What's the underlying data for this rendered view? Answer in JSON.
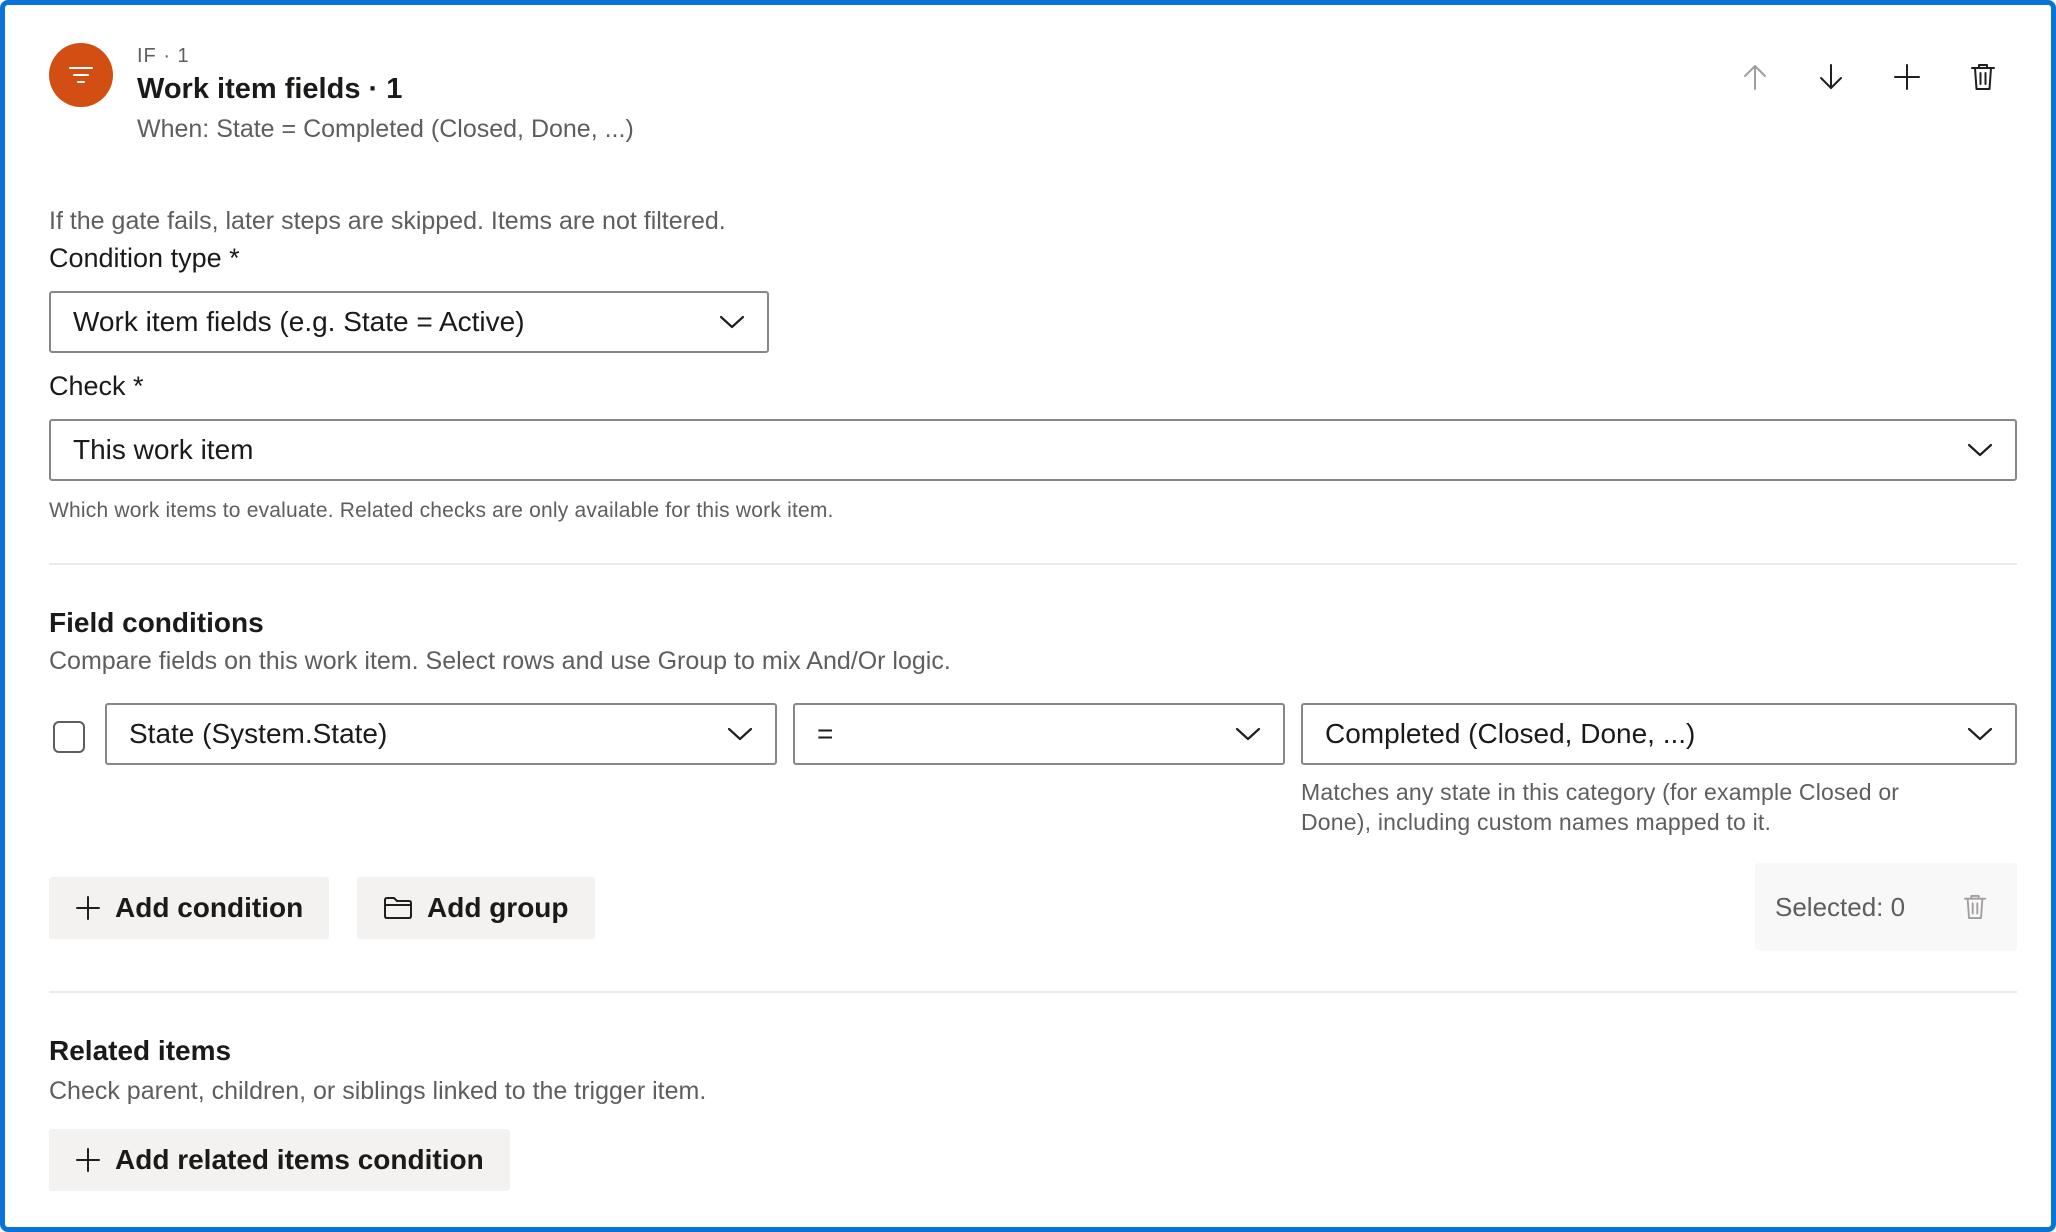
{
  "header": {
    "eyebrow": "IF · 1",
    "title": "Work item fields · 1",
    "subtitle": "When: State = Completed (Closed, Done, ...)",
    "icon": "filter-icon",
    "accent_color": "#d24e12"
  },
  "toolbar": {
    "move_up": "arrow-up-icon",
    "move_down": "arrow-down-icon",
    "add": "plus-icon",
    "delete": "trash-icon"
  },
  "gate_note": "If the gate fails, later steps are skipped. Items are not filtered.",
  "condition_type": {
    "label": "Condition type *",
    "value": "Work item fields (e.g. State = Active)"
  },
  "check": {
    "label": "Check *",
    "value": "This work item",
    "help": "Which work items to evaluate. Related checks are only available for this work item."
  },
  "field_conditions": {
    "title": "Field conditions",
    "description": "Compare fields on this work item. Select rows and use Group to mix And/Or logic.",
    "rows": [
      {
        "field": "State (System.State)",
        "operator": "=",
        "value": "Completed (Closed, Done, ...)",
        "help_line1": "Matches any state in this category (for example Closed or",
        "help_line2": "Done), including custom names mapped to it."
      }
    ],
    "add_condition_label": "Add condition",
    "add_group_label": "Add group",
    "selected_label": "Selected: 0"
  },
  "related_items": {
    "title": "Related items",
    "description": "Check parent, children, or siblings linked to the trigger item.",
    "add_label": "Add related items condition"
  },
  "colors": {
    "border": "#0a74d6",
    "accent": "#d24e12"
  }
}
